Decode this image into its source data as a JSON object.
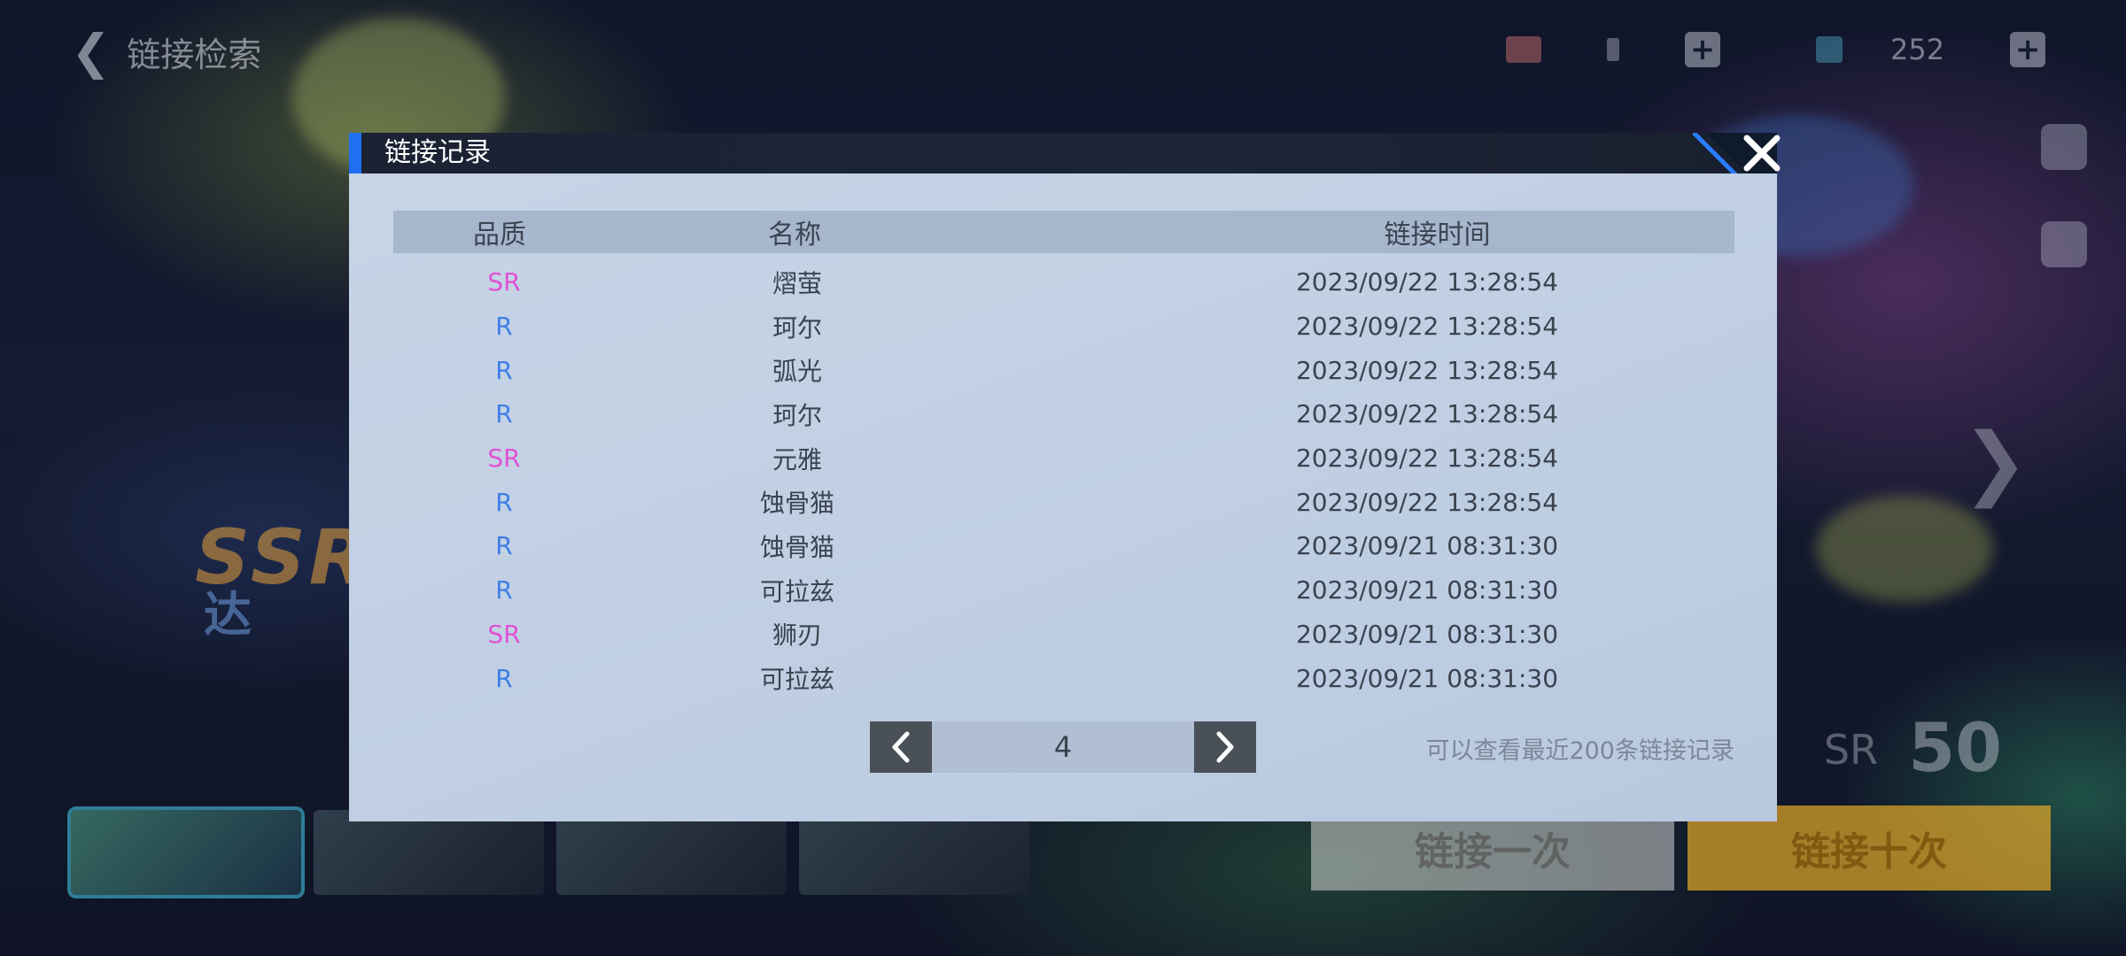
{
  "background": {
    "nav_title": "链接检索",
    "resource_2_value": "252",
    "promo_text": "SSR",
    "promo_subtext": "达",
    "summon_once_label": "链接一次",
    "summon_ten_label": "链接十次",
    "remaining_quality": "SR",
    "remaining_count": "50"
  },
  "modal": {
    "title": "链接记录",
    "columns": {
      "quality": "品质",
      "name": "名称",
      "time": "链接时间"
    },
    "rows": [
      {
        "quality": "SR",
        "name": "熠萤",
        "time": "2023/09/22 13:28:54"
      },
      {
        "quality": "R",
        "name": "珂尔",
        "time": "2023/09/22 13:28:54"
      },
      {
        "quality": "R",
        "name": "弧光",
        "time": "2023/09/22 13:28:54"
      },
      {
        "quality": "R",
        "name": "珂尔",
        "time": "2023/09/22 13:28:54"
      },
      {
        "quality": "SR",
        "name": "元雅",
        "time": "2023/09/22 13:28:54"
      },
      {
        "quality": "R",
        "name": "蚀骨猫",
        "time": "2023/09/22 13:28:54"
      },
      {
        "quality": "R",
        "name": "蚀骨猫",
        "time": "2023/09/21 08:31:30"
      },
      {
        "quality": "R",
        "name": "可拉兹",
        "time": "2023/09/21 08:31:30"
      },
      {
        "quality": "SR",
        "name": "狮刃",
        "time": "2023/09/21 08:31:30"
      },
      {
        "quality": "R",
        "name": "可拉兹",
        "time": "2023/09/21 08:31:30"
      }
    ],
    "pagination": {
      "current_page": "4"
    },
    "note": "可以查看最近200条链接记录"
  },
  "colors": {
    "quality_SR": "#e052d6",
    "quality_R": "#3f7fe6",
    "header_accent": "#1f6ff0"
  }
}
